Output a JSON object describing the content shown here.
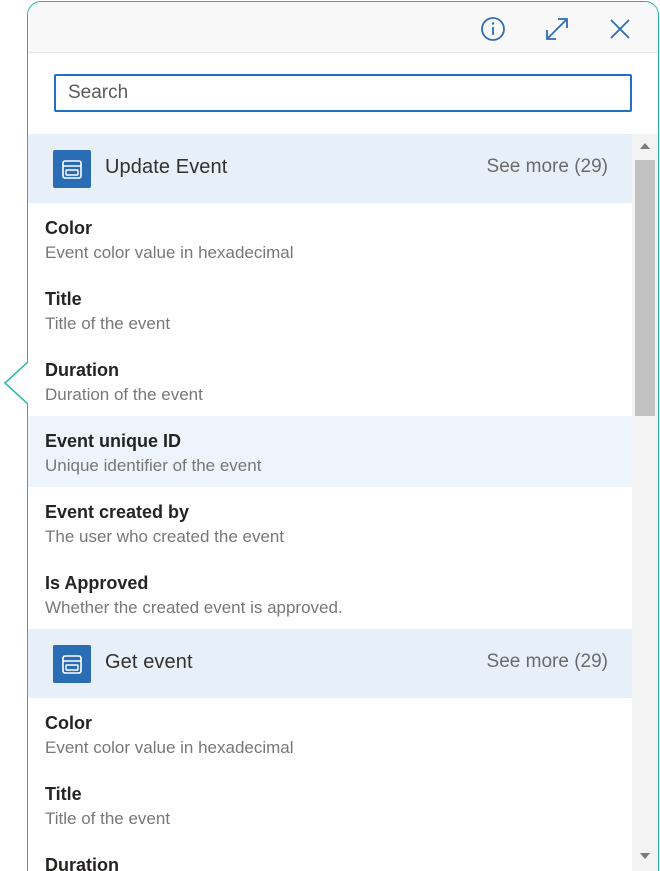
{
  "header": {
    "info_icon": "info-icon",
    "expand_icon": "expand-icon",
    "close_icon": "close-icon"
  },
  "search": {
    "placeholder": "Search",
    "value": ""
  },
  "colors": {
    "accent": "#1f6fc5",
    "panel_border": "#1db7a2",
    "group_header_bg": "#e7eff8",
    "selected_row_bg": "#eef4fb",
    "icon_bg": "#2a6db5"
  },
  "groups": [
    {
      "title": "Update Event",
      "see_more": "See more (29)",
      "icon": "calendar-event-icon",
      "items": [
        {
          "name": "Color",
          "desc": "Event color value in hexadecimal"
        },
        {
          "name": "Title",
          "desc": "Title of the event"
        },
        {
          "name": "Duration",
          "desc": "Duration of the event"
        },
        {
          "name": "Event unique ID",
          "desc": "Unique identifier of the event"
        },
        {
          "name": "Event created by",
          "desc": "The user who created the event"
        },
        {
          "name": "Is Approved",
          "desc": "Whether the created event is approved."
        }
      ]
    },
    {
      "title": "Get event",
      "see_more": "See more (29)",
      "icon": "calendar-event-icon",
      "items": [
        {
          "name": "Color",
          "desc": "Event color value in hexadecimal"
        },
        {
          "name": "Title",
          "desc": "Title of the event"
        },
        {
          "name": "Duration",
          "desc": ""
        }
      ]
    }
  ],
  "scrollbar": {
    "up_icon": "arrow-up-icon",
    "down_icon": "arrow-down-icon"
  }
}
